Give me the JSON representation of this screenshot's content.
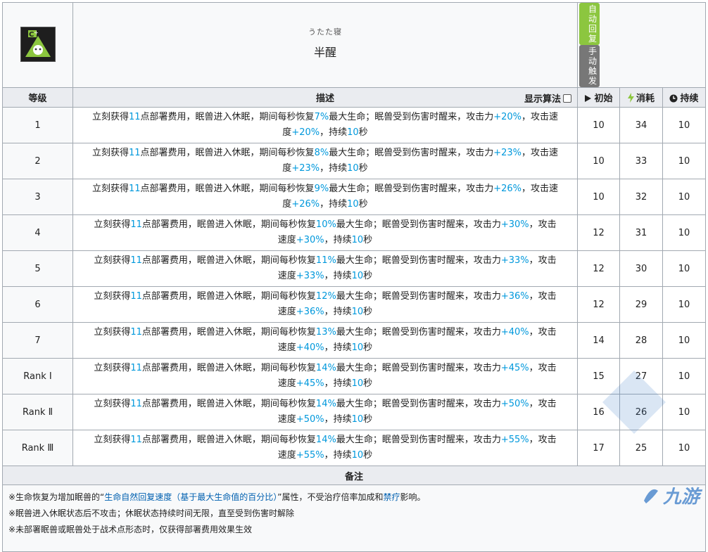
{
  "skill": {
    "icon": "sleeping-beast-skill-icon",
    "name_sub": "うたた寝",
    "name": "半醒",
    "tags": [
      "自动回复",
      "手动触发"
    ]
  },
  "columns": {
    "level": "等级",
    "desc": "描述",
    "toggle_label": "显示算法",
    "init": "初始",
    "cost": "消耗",
    "duration": "持续"
  },
  "rows": [
    {
      "level": "1",
      "sp": "11",
      "heal": "7%",
      "atk": "+20%",
      "aspd": "+20%",
      "dur": "10",
      "init": "10",
      "cost": "34",
      "duration": "10",
      "wrap": "a"
    },
    {
      "level": "2",
      "sp": "11",
      "heal": "8%",
      "atk": "+23%",
      "aspd": "+23%",
      "dur": "10",
      "init": "10",
      "cost": "33",
      "duration": "10",
      "wrap": "a"
    },
    {
      "level": "3",
      "sp": "11",
      "heal": "9%",
      "atk": "+26%",
      "aspd": "+26%",
      "dur": "10",
      "init": "10",
      "cost": "32",
      "duration": "10",
      "wrap": "a"
    },
    {
      "level": "4",
      "sp": "11",
      "heal": "10%",
      "atk": "+30%",
      "aspd": "+30%",
      "dur": "10",
      "init": "12",
      "cost": "31",
      "duration": "10",
      "wrap": "b"
    },
    {
      "level": "5",
      "sp": "11",
      "heal": "11%",
      "atk": "+33%",
      "aspd": "+33%",
      "dur": "10",
      "init": "12",
      "cost": "30",
      "duration": "10",
      "wrap": "b"
    },
    {
      "level": "6",
      "sp": "11",
      "heal": "12%",
      "atk": "+36%",
      "aspd": "+36%",
      "dur": "10",
      "init": "12",
      "cost": "29",
      "duration": "10",
      "wrap": "b"
    },
    {
      "level": "7",
      "sp": "11",
      "heal": "13%",
      "atk": "+40%",
      "aspd": "+40%",
      "dur": "10",
      "init": "14",
      "cost": "28",
      "duration": "10",
      "wrap": "b"
    },
    {
      "level": "Rank Ⅰ",
      "sp": "11",
      "heal": "14%",
      "atk": "+45%",
      "aspd": "+45%",
      "dur": "10",
      "init": "15",
      "cost": "27",
      "duration": "10",
      "wrap": "b"
    },
    {
      "level": "Rank Ⅱ",
      "sp": "11",
      "heal": "14%",
      "atk": "+50%",
      "aspd": "+50%",
      "dur": "10",
      "init": "16",
      "cost": "26",
      "duration": "10",
      "wrap": "b"
    },
    {
      "level": "Rank Ⅲ",
      "sp": "11",
      "heal": "14%",
      "atk": "+55%",
      "aspd": "+55%",
      "dur": "10",
      "init": "17",
      "cost": "25",
      "duration": "10",
      "wrap": "b"
    }
  ],
  "desc_text": {
    "p1": "立刻获得",
    "p2": "点部署费用，眠兽进入休眠，期间每秒恢复",
    "p3": "最大生命；眠兽受到伤害时醒来，攻击力",
    "p4a": "，攻击速",
    "p4b": "，攻击",
    "p5a": "度",
    "p5b": "速度",
    "p6": "，持续",
    "p7": "秒"
  },
  "notes": {
    "heading": "备注",
    "line1_a": "※生命恢复为增加眠兽的“",
    "line1_b": "生命自然回复速度（基于最大生命值的百分比）",
    "line1_c": "”属性，不受治疗倍率加成和",
    "line1_d": "禁疗",
    "line1_e": "影响。",
    "line2": "※眠兽进入休眠状态后不攻击；休眠状态持续时间无限，直至受到伤害时解除",
    "line3": "※未部署眠兽或眠兽处于战术点形态时，仅获得部署费用效果生效"
  },
  "watermark": "九游"
}
